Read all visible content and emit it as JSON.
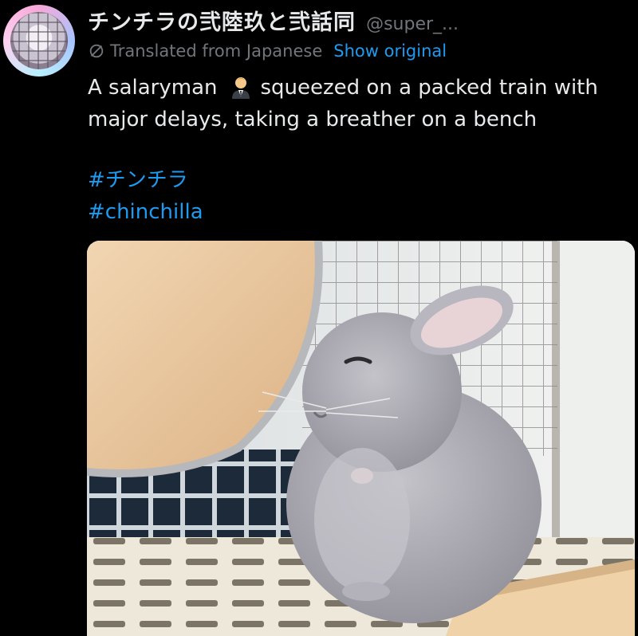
{
  "tweet": {
    "display_name": "チンチラの弐陸玖と弐話同",
    "handle": "@super_...",
    "translated_from": "Translated from Japanese",
    "show_original": "Show original",
    "text_before_emoji": "A salaryman",
    "emoji": "man-office-worker-emoji",
    "text_after_emoji": "squeezed on a packed train with major delays, taking a breather on a bench",
    "hashtags": [
      "#チンチラ",
      "#chinchilla"
    ]
  },
  "media": {
    "subject": "chinchilla-photo",
    "colors": {
      "fur": "#a9a8b0",
      "wood": "#ebc9a2",
      "tile": "#1c2a3a",
      "floor": "#e9e2d2"
    }
  },
  "theme": {
    "background": "#000000",
    "text": "#e7e9ea",
    "muted": "#71767b",
    "link": "#1d9bf0"
  }
}
